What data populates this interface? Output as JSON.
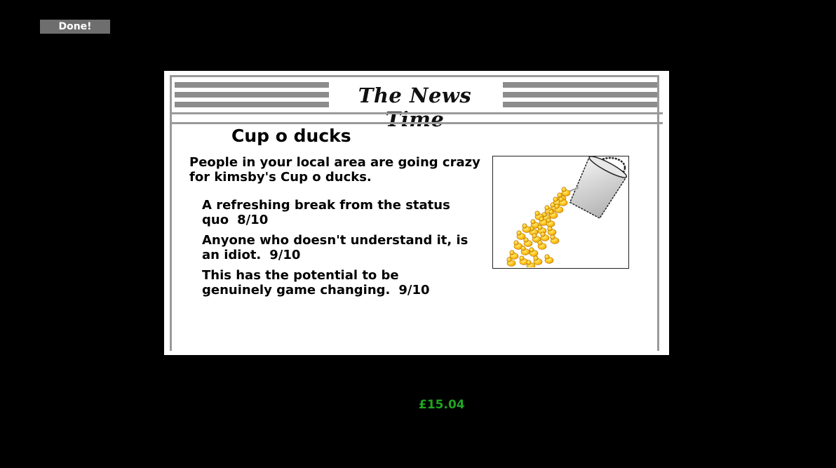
{
  "done_button": {
    "label": "Done!"
  },
  "newspaper": {
    "masthead": "The News Time",
    "headline": "Cup o ducks",
    "lead": "People in your local area are going crazy for kimsby's Cup o ducks.",
    "reviews": [
      {
        "text": "A refreshing break from the status quo",
        "score": "8/10"
      },
      {
        "text": "Anyone who doesn't understand it, is an idiot.",
        "score": "9/10"
      },
      {
        "text": "This has the potential to be genuinely game changing.",
        "score": "9/10"
      }
    ],
    "image": {
      "icon": "cup-pouring-ducks-icon"
    }
  },
  "money": {
    "value": "£15.04",
    "color": "#1fa51f"
  }
}
